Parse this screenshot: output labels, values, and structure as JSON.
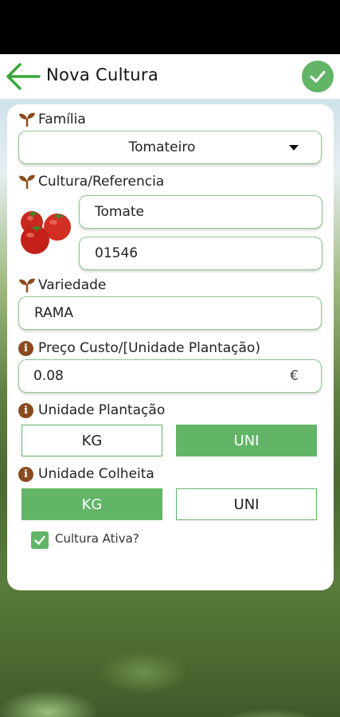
{
  "header": {
    "title": "Nova Cultura"
  },
  "familia": {
    "label": "Família",
    "value": "Tomateiro"
  },
  "cultura": {
    "label": "Cultura/Referencia",
    "name": "Tomate",
    "reference": "01546"
  },
  "variedade": {
    "label": "Variedade",
    "value": "RAMA"
  },
  "preco": {
    "label": "Preço Custo/[Unidade Plantação)",
    "value": "0.08",
    "currency": "€"
  },
  "unidade_plantacao": {
    "label": "Unidade Plantação",
    "options": [
      "KG",
      "UNI"
    ],
    "selected": "UNI"
  },
  "unidade_colheita": {
    "label": "Unidade Colheita",
    "options": [
      "KG",
      "UNI"
    ],
    "selected": "KG"
  },
  "ativa": {
    "label": "Cultura Ativa?",
    "checked": true
  },
  "colors": {
    "accent": "#62b466",
    "info": "#8b4a1e",
    "field_border": "#8cc98c"
  },
  "icons": {
    "back": "arrow-left-icon",
    "confirm": "check-icon",
    "plant": "sprout-icon",
    "info": "info-icon",
    "dropdown": "caret-down-icon",
    "tomato": "tomato-image"
  }
}
